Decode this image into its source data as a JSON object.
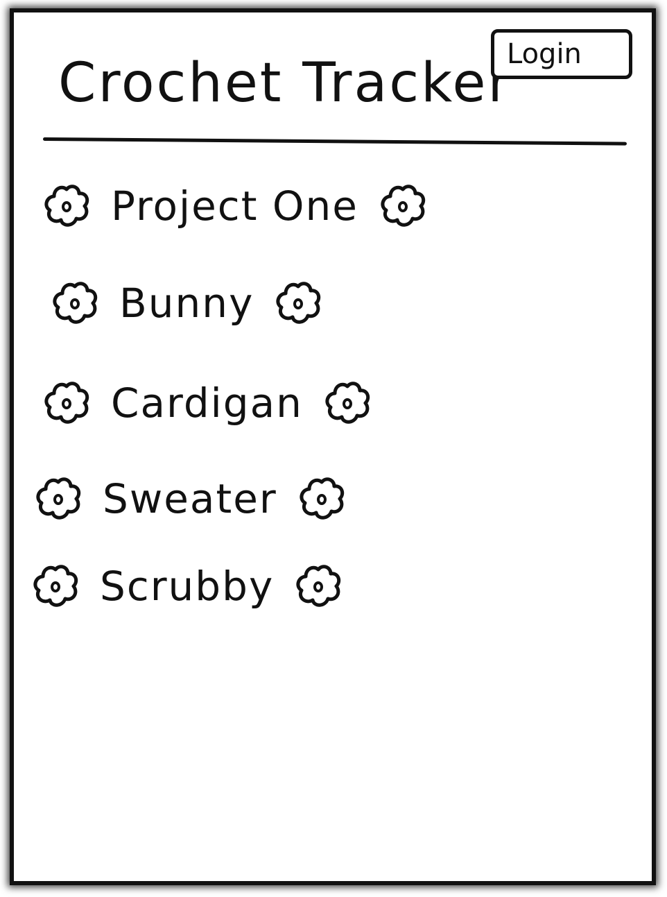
{
  "header": {
    "title": "Crochet Tracker",
    "login_label": "Login"
  },
  "projects": [
    {
      "label": "Project One",
      "icon": "flower-icon"
    },
    {
      "label": "Bunny",
      "icon": "flower-icon"
    },
    {
      "label": "Cardigan",
      "icon": "flower-icon"
    },
    {
      "label": "Sweater",
      "icon": "flower-icon"
    },
    {
      "label": "Scrubby",
      "icon": "flower-icon"
    }
  ],
  "colors": {
    "ink": "#111111",
    "background": "#ffffff"
  }
}
